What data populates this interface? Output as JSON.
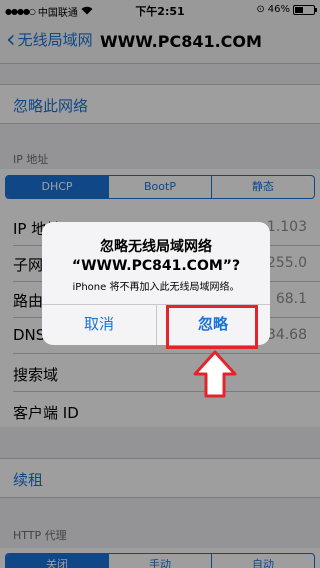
{
  "status": {
    "carrier": "中国联通",
    "time": "下午2:51",
    "battery": "46%",
    "battery_level": 0.46
  },
  "nav": {
    "back_label": "无线局域网",
    "title": "WWW.PC841.COM"
  },
  "forget": "忽略此网络",
  "ip_header": "IP 地址",
  "ip_segments": [
    "DHCP",
    "BootP",
    "静态"
  ],
  "rows": {
    "ip": {
      "label": "IP 地址",
      "value": "1.103"
    },
    "subnet": {
      "label": "子网",
      "value": "255.0"
    },
    "router": {
      "label": "路由",
      "value": "68.1"
    },
    "dns": {
      "label": "DNS",
      "value": "34.68"
    },
    "search": {
      "label": "搜索域"
    },
    "client": {
      "label": "客户端 ID"
    }
  },
  "renew": "续租",
  "http_header": "HTTP 代理",
  "http_segments": [
    "关闭",
    "手动",
    "自动"
  ],
  "alert": {
    "title": "忽略无线局域网络",
    "subtitle": "“WWW.PC841.COM”?",
    "message": "iPhone 将不再加入此无线局域网络。",
    "cancel": "取消",
    "confirm": "忽略"
  },
  "colors": {
    "accent": "#1a73d9",
    "highlight": "#e3242b"
  }
}
